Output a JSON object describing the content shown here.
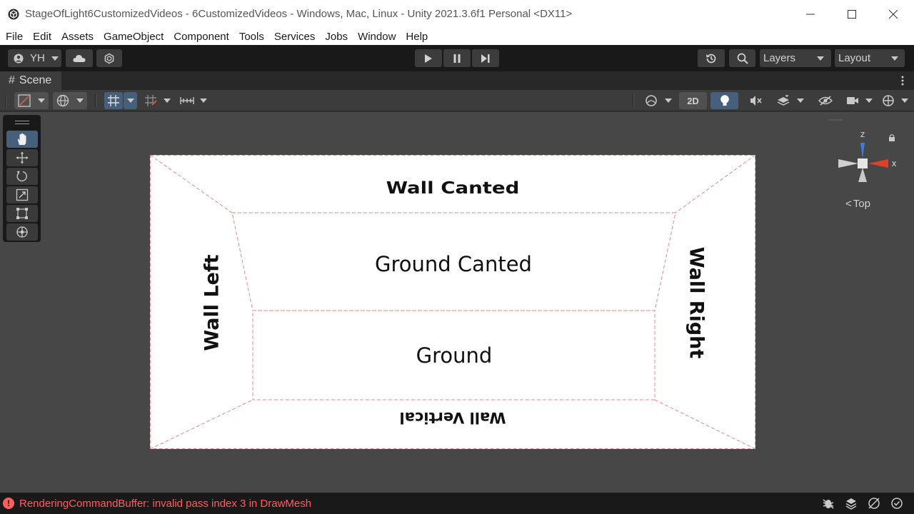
{
  "window": {
    "title": "StageOfLight6CustomizedVideos - 6CustomizedVideos - Windows, Mac, Linux - Unity 2021.3.6f1 Personal <DX11>"
  },
  "menu": {
    "items": [
      "File",
      "Edit",
      "Assets",
      "GameObject",
      "Component",
      "Tools",
      "Services",
      "Jobs",
      "Window",
      "Help"
    ]
  },
  "toolbar": {
    "account_label": "YH",
    "layers_label": "Layers",
    "layout_label": "Layout"
  },
  "scene_tab": {
    "label": "Scene"
  },
  "scene_toolbar": {
    "toggle_2d_label": "2D"
  },
  "stage": {
    "wall_canted": "Wall Canted",
    "ground_canted": "Ground Canted",
    "ground": "Ground",
    "wall_left": "Wall Left",
    "wall_right": "Wall Right",
    "wall_vertical": "Wall Vertical"
  },
  "gizmo": {
    "axis_z": "z",
    "axis_x": "x",
    "view_label": "Top"
  },
  "status": {
    "message": "RenderingCommandBuffer: invalid pass index 3 in DrawMesh"
  },
  "colors": {
    "accent_active": "#46607c",
    "error_text": "#ff5e5e",
    "gizmo_x": "#e0402b",
    "gizmo_z": "#3a7de0"
  },
  "icons": [
    "unity-logo-icon",
    "minimize-icon",
    "maximize-icon",
    "close-icon",
    "account-icon",
    "cloud-icon",
    "collab-icon",
    "play-icon",
    "pause-icon",
    "step-icon",
    "history-icon",
    "search-icon",
    "hand-tool-icon",
    "move-tool-icon",
    "rotate-tool-icon",
    "scale-tool-icon",
    "rect-tool-icon",
    "transform-tool-icon",
    "lock-icon",
    "error-icon"
  ]
}
